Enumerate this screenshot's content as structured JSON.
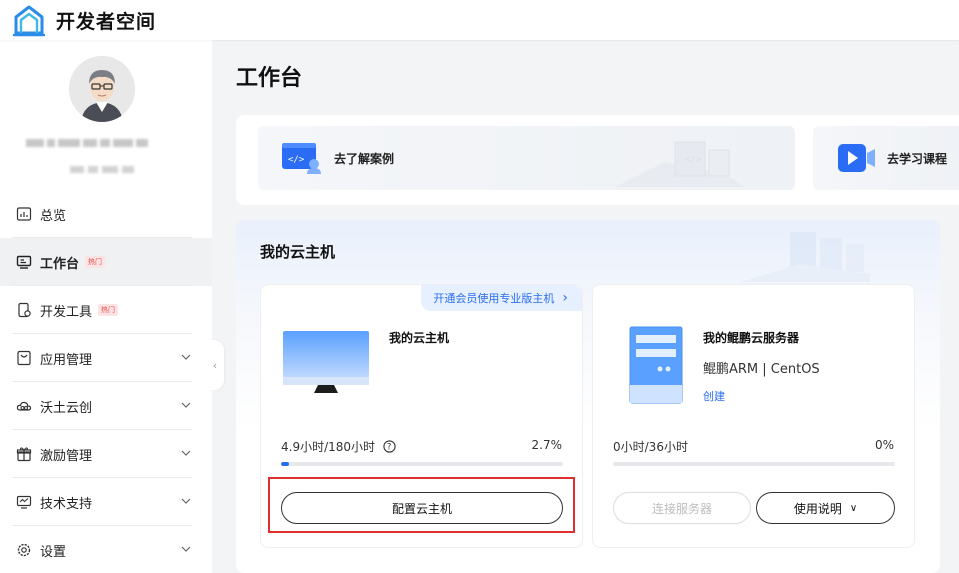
{
  "header": {
    "brand": "开发者空间"
  },
  "sidebar": {
    "items": [
      {
        "label": "总览",
        "badge": "",
        "chevron": false,
        "active": false
      },
      {
        "label": "工作台",
        "badge": "热门",
        "chevron": false,
        "active": true
      },
      {
        "label": "开发工具",
        "badge": "热门",
        "chevron": false,
        "active": false
      },
      {
        "label": "应用管理",
        "badge": "",
        "chevron": true,
        "active": false
      },
      {
        "label": "沃土云创",
        "badge": "",
        "chevron": true,
        "active": false
      },
      {
        "label": "激励管理",
        "badge": "",
        "chevron": true,
        "active": false
      },
      {
        "label": "技术支持",
        "badge": "",
        "chevron": true,
        "active": false
      },
      {
        "label": "设置",
        "badge": "",
        "chevron": true,
        "active": false
      }
    ],
    "collapse_glyph": "‹"
  },
  "main": {
    "title": "工作台",
    "quick": [
      {
        "label": "去了解案例"
      },
      {
        "label": "去学习课程"
      }
    ],
    "section_title": "我的云主机",
    "vm1": {
      "promo": "开通会员使用专业版主机",
      "promo_chevron": "›",
      "name": "我的云主机",
      "usage": "4.9小时/180小时",
      "percent": "2.7%",
      "progress": 0.027,
      "button": "配置云主机"
    },
    "vm2": {
      "name": "我的鲲鹏云服务器",
      "spec": "鲲鹏ARM | CentOS",
      "link": "创建",
      "usage": "0小时/36小时",
      "percent": "0%",
      "progress": 0,
      "btn_connect": "连接服务器",
      "btn_help": "使用说明",
      "btn_help_chevron": "∨"
    }
  },
  "colors": {
    "accent": "#2a6df4",
    "highlight_frame": "#e12f2f"
  }
}
